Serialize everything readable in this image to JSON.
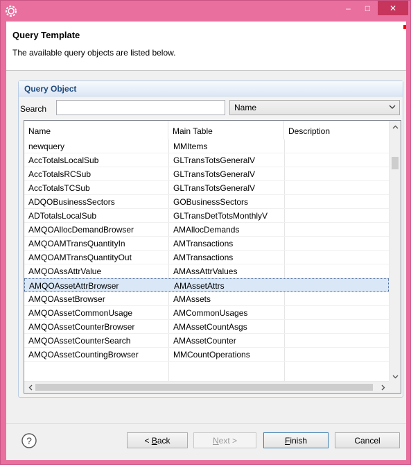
{
  "window": {
    "min_glyph": "–",
    "max_glyph": "□",
    "close_glyph": "✕"
  },
  "header": {
    "title": "Query Template",
    "description": "The available query objects are listed below."
  },
  "section": {
    "title": "Query Object"
  },
  "search": {
    "label": "Search",
    "value": "",
    "field_options_selected": "Name"
  },
  "table": {
    "columns": [
      "Name",
      "Main Table",
      "Description"
    ],
    "rows": [
      {
        "name": "newquery",
        "main_table": "MMItems",
        "description": ""
      },
      {
        "name": "AccTotalsLocalSub",
        "main_table": "GLTransTotsGeneralV",
        "description": ""
      },
      {
        "name": "AccTotalsRCSub",
        "main_table": "GLTransTotsGeneralV",
        "description": ""
      },
      {
        "name": "AccTotalsTCSub",
        "main_table": "GLTransTotsGeneralV",
        "description": ""
      },
      {
        "name": "ADQOBusinessSectors",
        "main_table": "GOBusinessSectors",
        "description": ""
      },
      {
        "name": "ADTotalsLocalSub",
        "main_table": "GLTransDetTotsMonthlyV",
        "description": ""
      },
      {
        "name": "AMQOAllocDemandBrowser",
        "main_table": "AMAllocDemands",
        "description": ""
      },
      {
        "name": "AMQOAMTransQuantityIn",
        "main_table": "AMTransactions",
        "description": ""
      },
      {
        "name": "AMQOAMTransQuantityOut",
        "main_table": "AMTransactions",
        "description": ""
      },
      {
        "name": "AMQOAssAttrValue",
        "main_table": "AMAssAttrValues",
        "description": ""
      },
      {
        "name": "AMQOAssetAttrBrowser",
        "main_table": "AMAssetAttrs",
        "description": "",
        "selected": true
      },
      {
        "name": "AMQOAssetBrowser",
        "main_table": "AMAssets",
        "description": ""
      },
      {
        "name": "AMQOAssetCommonUsage",
        "main_table": "AMCommonUsages",
        "description": ""
      },
      {
        "name": "AMQOAssetCounterBrowser",
        "main_table": "AMAssetCountAsgs",
        "description": ""
      },
      {
        "name": "AMQOAssetCounterSearch",
        "main_table": "AMAssetCounter",
        "description": ""
      },
      {
        "name": "AMQOAssetCountingBrowser",
        "main_table": "MMCountOperations",
        "description": ""
      }
    ]
  },
  "footer": {
    "help_glyph": "?",
    "back_label": "< Back",
    "back_mnemonic": "B",
    "next_label": "Next >",
    "finish_label": "Finish",
    "cancel_label": "Cancel",
    "next_enabled": false
  },
  "scroll": {
    "up_glyph": "^",
    "down_glyph": "v",
    "left_glyph": "<",
    "right_glyph": ">"
  },
  "colors": {
    "titlebar": "#e96f9f",
    "close_button": "#c7355c",
    "selected_row": "#d9e7f7",
    "section_title": "#1f4a7d"
  }
}
